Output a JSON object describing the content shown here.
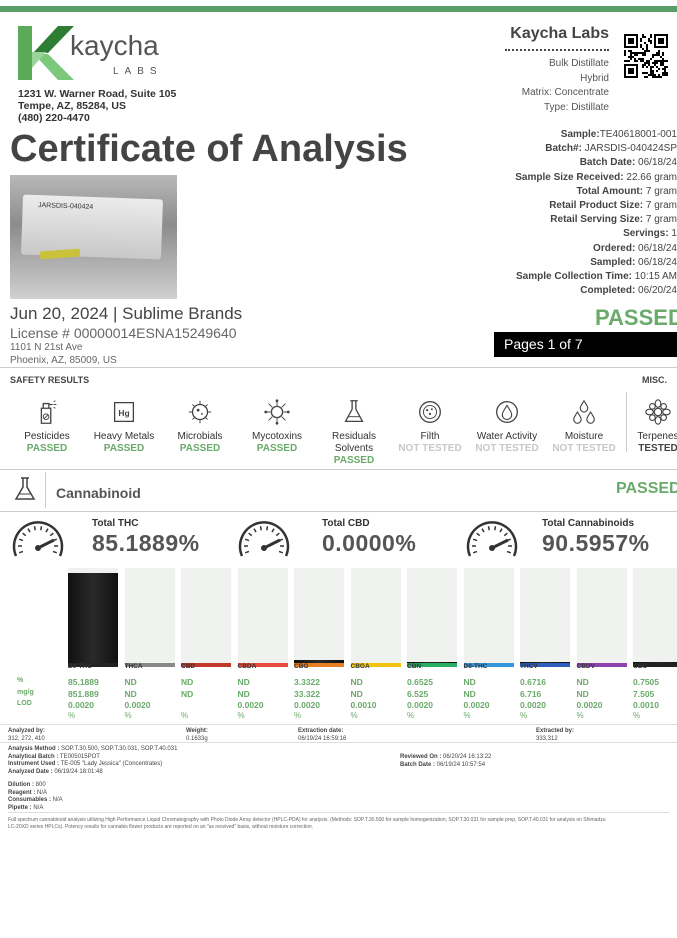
{
  "header": {
    "brand": "kaycha",
    "brand_sub": "LABS",
    "address": [
      "1231 W. Warner Road, Suite 105",
      "Tempe, AZ, 85284, US",
      "(480) 220-4470"
    ],
    "lab_name": "Kaycha Labs",
    "lab_info": [
      "Bulk Distillate",
      "Hybrid",
      "Matrix: Concentrate",
      "Type: Distillate"
    ]
  },
  "title": "Certificate of Analysis",
  "photo_label": "JARSDIS-040424",
  "sample": [
    {
      "k": "Sample:",
      "v": "TE40618001-001"
    },
    {
      "k": "Batch#:",
      "v": " JARSDIS-040424SP"
    },
    {
      "k": "Batch Date:",
      "v": " 06/18/24"
    },
    {
      "k": "Sample Size Received:",
      "v": " 22.66 gram"
    },
    {
      "k": "Total Amount:",
      "v": " 7 gram"
    },
    {
      "k": "Retail Product Size:",
      "v": " 7 gram"
    },
    {
      "k": "Retail Serving Size:",
      "v": " 7 gram"
    },
    {
      "k": "Servings:",
      "v": " 1"
    },
    {
      "k": "Ordered:",
      "v": " 06/18/24"
    },
    {
      "k": "Sampled:",
      "v": " 06/18/24"
    },
    {
      "k": "Sample Collection Time:",
      "v": " 10:15 AM"
    },
    {
      "k": "Completed:",
      "v": " 06/20/24"
    }
  ],
  "client": {
    "date_brand": "Jun 20, 2024 | Sublime Brands",
    "license": "License # 00000014ESNA15249640",
    "address": [
      "1101 N 21st Ave",
      "Phoenix, AZ, 85009, US"
    ]
  },
  "status_big": "PASSED",
  "pages": "Pages 1 of 7",
  "safety": {
    "title": "SAFETY RESULTS",
    "misc": "MISC.",
    "items": [
      {
        "name": "Pesticides",
        "status": "PASSED",
        "cls": "ok",
        "icon": "pesticide-spray-icon"
      },
      {
        "name": "Heavy Metals",
        "status": "PASSED",
        "cls": "ok",
        "icon": "heavy-metal-icon"
      },
      {
        "name": "Microbials",
        "status": "PASSED",
        "cls": "ok",
        "icon": "microbe-icon"
      },
      {
        "name": "Mycotoxins",
        "status": "PASSED",
        "cls": "ok",
        "icon": "virus-icon"
      },
      {
        "name": "Residuals Solvents",
        "status": "PASSED",
        "cls": "ok",
        "icon": "flask-icon"
      },
      {
        "name": "Filth",
        "status": "NOT TESTED",
        "cls": "nt",
        "icon": "filth-icon"
      },
      {
        "name": "Water Activity",
        "status": "NOT TESTED",
        "cls": "nt",
        "icon": "water-drop-icon"
      },
      {
        "name": "Moisture",
        "status": "NOT TESTED",
        "cls": "nt",
        "icon": "moisture-icon"
      },
      {
        "name": "Terpenes",
        "status": "TESTED",
        "cls": "tst",
        "icon": "terpene-flower-icon"
      }
    ]
  },
  "cannabinoid": {
    "title": "Cannabinoid",
    "status": "PASSED",
    "totals": [
      {
        "label": "Total THC",
        "value": "85.1889%"
      },
      {
        "label": "Total CBD",
        "value": "0.0000%"
      },
      {
        "label": "Total Cannabinoids",
        "value": "90.5957%"
      }
    ],
    "row_labels": [
      "%",
      "mg/g",
      "LOD",
      ""
    ],
    "compounds": [
      {
        "name": "D9-THC",
        "pct": "85.1889",
        "mg": "851.889",
        "lod": "0.0020",
        "unit": "%",
        "level": 0.95,
        "color": "#222222"
      },
      {
        "name": "THCA",
        "pct": "ND",
        "mg": "ND",
        "lod": "0.0020",
        "unit": "%",
        "level": 0,
        "color": "#888888"
      },
      {
        "name": "CBD",
        "pct": "ND",
        "mg": "ND",
        "lod": "",
        "unit": "%",
        "level": 0,
        "color": "#c0392b"
      },
      {
        "name": "CBDA",
        "pct": "ND",
        "mg": "ND",
        "lod": "0.0020",
        "unit": "%",
        "level": 0,
        "color": "#e74c3c"
      },
      {
        "name": "CBG",
        "pct": "3.3322",
        "mg": "33.322",
        "lod": "0.0020",
        "unit": "%",
        "level": 0.03,
        "color": "#e67e22"
      },
      {
        "name": "CBGA",
        "pct": "ND",
        "mg": "ND",
        "lod": "0.0010",
        "unit": "%",
        "level": 0,
        "color": "#f1c40f"
      },
      {
        "name": "CBN",
        "pct": "0.6525",
        "mg": "6.525",
        "lod": "0.0020",
        "unit": "%",
        "level": 0.01,
        "color": "#27ae60"
      },
      {
        "name": "D8-THC",
        "pct": "ND",
        "mg": "ND",
        "lod": "0.0020",
        "unit": "%",
        "level": 0,
        "color": "#3498db"
      },
      {
        "name": "THCV",
        "pct": "0.6716",
        "mg": "6.716",
        "lod": "0.0020",
        "unit": "%",
        "level": 0.01,
        "color": "#2e5fbf"
      },
      {
        "name": "CBDV",
        "pct": "ND",
        "mg": "ND",
        "lod": "0.0020",
        "unit": "%",
        "level": 0,
        "color": "#8e44ad"
      },
      {
        "name": "CBC",
        "pct": "0.7505",
        "mg": "7.505",
        "lod": "0.0010",
        "unit": "%",
        "level": 0.01,
        "color": "#222222"
      }
    ]
  },
  "analysis": {
    "analyzed_by_k": "Analyzed by:",
    "analyzed_by_v": "312, 272, 410",
    "weight_k": "Weight:",
    "weight_v": "0.1633g",
    "extraction_k": "Extraction date:",
    "extraction_v": "06/19/24 16:59:16",
    "extracted_by_k": "Extracted by:",
    "extracted_by_v": "333,312",
    "method_k": "Analysis Method :",
    "method_v": " SOP.T.30.500, SOP.T.30.031, SOP.T.40.031",
    "batch_k": "Analytical Batch :",
    "batch_v": " TE005015POT",
    "instrument_k": "Instrument Used :",
    "instrument_v": " TE-005 \"Lady Jessica\" (Concentrates)",
    "adate_k": "Analyzed Date :",
    "adate_v": " 06/19/24 18:01:48",
    "reviewed_k": "Reviewed On :",
    "reviewed_v": " 06/20/24 16:13:22",
    "bdate_k": "Batch Date :",
    "bdate_v": " 06/19/24 10:57:54",
    "dilution_k": "Dilution :",
    "dilution_v": " 800",
    "reagent_k": "Reagent :",
    "reagent_v": " N/A",
    "consumables_k": "Consumables :",
    "consumables_v": " N/A",
    "pipette_k": "Pipette :",
    "pipette_v": " N/A"
  },
  "footnote": [
    "Full spectrum cannabinoid analysis utilizing High Performance Liquid Chromatography with Photo Diode Array detector (HPLC-PDA) for analysis. (Methods: SOP.T.30.500 for sample homogenization, SOP.T.30.031 for sample prep, SOP.T.40.031 for analysis on Shimadzu",
    "LC-20XD series HPLCs). Potency results for cannabis flower products are reported on an \"as received\" basis, without moisture correction."
  ]
}
